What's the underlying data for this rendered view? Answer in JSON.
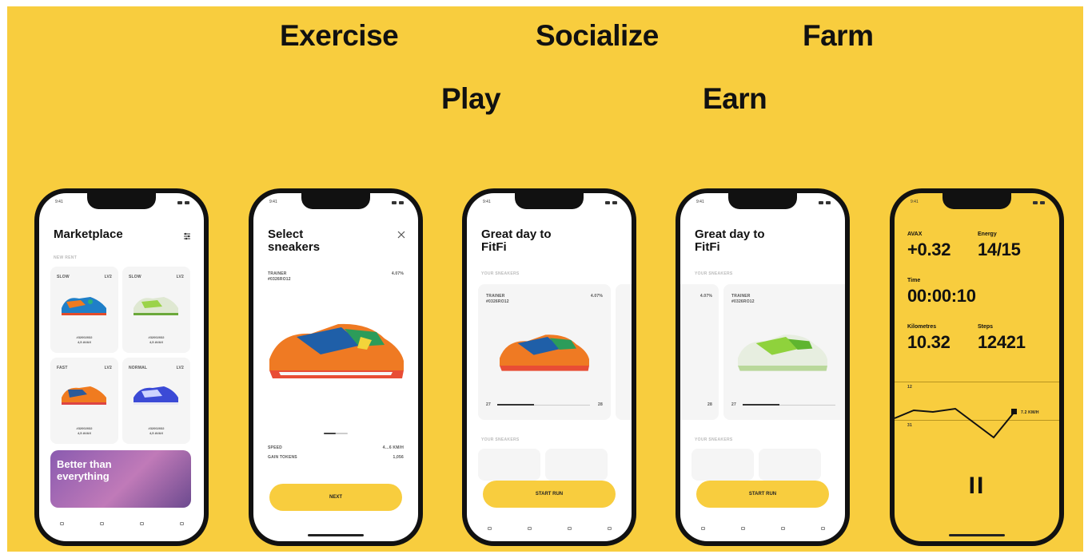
{
  "taglines": [
    "Exercise",
    "Socialize",
    "Farm",
    "Play",
    "Earn"
  ],
  "colors": {
    "brand_yellow": "#f8cd3e",
    "text": "#111111"
  },
  "status_time": "9:41",
  "marketplace": {
    "title": "Marketplace",
    "section": "NEW RENT",
    "cards": [
      {
        "speed": "SLOW",
        "level": "LV2",
        "id": "#32002032",
        "price": "4,5 AVAX"
      },
      {
        "speed": "SLOW",
        "level": "LV2",
        "id": "#32002032",
        "price": "4,5 AVAX"
      },
      {
        "speed": "FAST",
        "level": "LV2",
        "id": "#32002032",
        "price": "4,5 AVAX"
      },
      {
        "speed": "NORMAL",
        "level": "LV2",
        "id": "#32002032",
        "price": "4,5 AVAX"
      }
    ],
    "promo": "Better than everything"
  },
  "select": {
    "title": "Select sneakers",
    "sneaker_name": "TRAINER",
    "sneaker_id": "#0326RO12",
    "bonus": "4.07%",
    "speed_label": "SPEED",
    "speed_value": "4…6 KM/H",
    "gain_label": "GAIN TOKENS",
    "gain_value": "1,056",
    "next": "NEXT"
  },
  "fitfi1": {
    "title": "Great day to FitFi",
    "section": "YOUR SNEAKERS",
    "sneaker_name": "TRAINER",
    "sneaker_id": "#0326RO12",
    "bonus": "4.07%",
    "range_min": "27",
    "range_max": "28",
    "section2": "YOUR SNEAKERS",
    "start": "START RUN"
  },
  "fitfi2": {
    "title": "Great day to FitFi",
    "section": "YOUR SNEAKERS",
    "sneaker_name": "TRAINER",
    "sneaker_id": "#0326RO12",
    "bonus": "4.07%",
    "range_min": "27",
    "range_max": "28",
    "section2": "YOUR SNEAKERS",
    "start": "START RUN"
  },
  "run": {
    "avax_label": "AVAX",
    "avax_value": "+0.32",
    "energy_label": "Energy",
    "energy_value": "14/15",
    "time_label": "Time",
    "time_value": "00:00:10",
    "km_label": "Kilometres",
    "km_value": "10.32",
    "steps_label": "Steps",
    "steps_value": "12421",
    "chart_top": "12",
    "chart_bottom": "31",
    "pace": "7.2 KM/H",
    "pause": "II"
  }
}
